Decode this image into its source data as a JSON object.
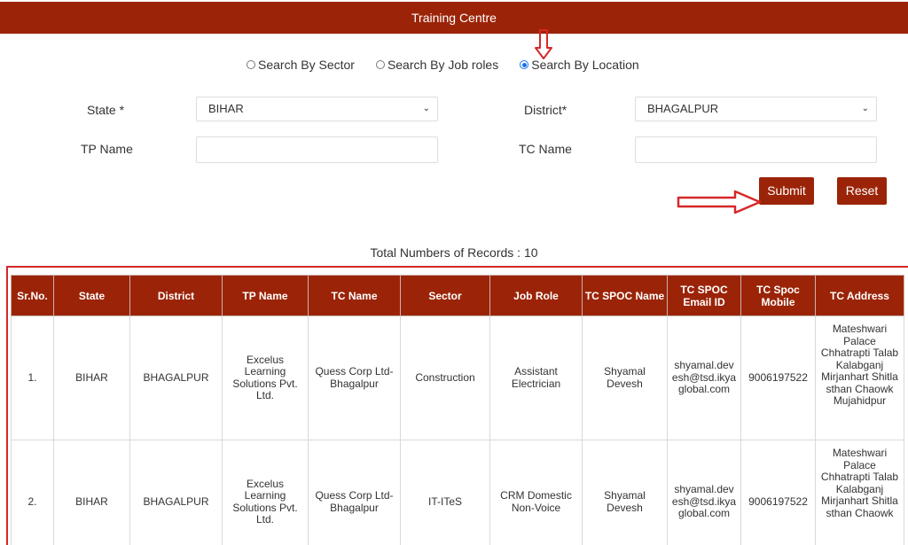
{
  "header": {
    "title": "Training Centre"
  },
  "search_options": [
    {
      "label": "Search By Sector",
      "checked": false
    },
    {
      "label": "Search By Job roles",
      "checked": false
    },
    {
      "label": "Search By Location",
      "checked": true
    }
  ],
  "form": {
    "state_label": "State *",
    "state_value": "BIHAR",
    "district_label": "District*",
    "district_value": "BHAGALPUR",
    "tp_label": "TP Name",
    "tp_value": "",
    "tc_label": "TC Name",
    "tc_value": ""
  },
  "buttons": {
    "submit": "Submit",
    "reset": "Reset"
  },
  "records_text": "Total Numbers of Records : 10",
  "table": {
    "headers": [
      "Sr.No.",
      "State",
      "District",
      "TP Name",
      "TC Name",
      "Sector",
      "Job Role",
      "TC SPOC Name",
      "TC SPOC Email ID",
      "TC Spoc Mobile",
      "TC Address"
    ],
    "rows": [
      {
        "sr": "1.",
        "state": "BIHAR",
        "district": "BHAGALPUR",
        "tp_name": "Excelus Learning Solutions Pvt. Ltd.",
        "tc_name": "Quess Corp Ltd- Bhagalpur",
        "sector": "Construction",
        "job_role": "Assistant Electrician",
        "spoc_name": "Shyamal Devesh",
        "spoc_email": "shyamal.devesh@tsd.ikyaglobal.com",
        "spoc_mobile": "9006197522",
        "address": "Mateshwari Palace Chhatrapti Talab Kalabganj Mirjanhart Shitla sthan Chaowk Mujahidpur"
      },
      {
        "sr": "2.",
        "state": "BIHAR",
        "district": "BHAGALPUR",
        "tp_name": "Excelus Learning Solutions Pvt. Ltd.",
        "tc_name": "Quess Corp Ltd- Bhagalpur",
        "sector": "IT-ITeS",
        "job_role": "CRM Domestic Non-Voice",
        "spoc_name": "Shyamal Devesh",
        "spoc_email": "shyamal.devesh@tsd.ikyaglobal.com",
        "spoc_mobile": "9006197522",
        "address": "Mateshwari Palace Chhatrapti Talab Kalabganj Mirjanhart Shitla sthan Chaowk"
      }
    ]
  },
  "colors": {
    "brand": "#9b2408",
    "annotation": "#d62828",
    "radio_selected": "#1a73e8"
  }
}
